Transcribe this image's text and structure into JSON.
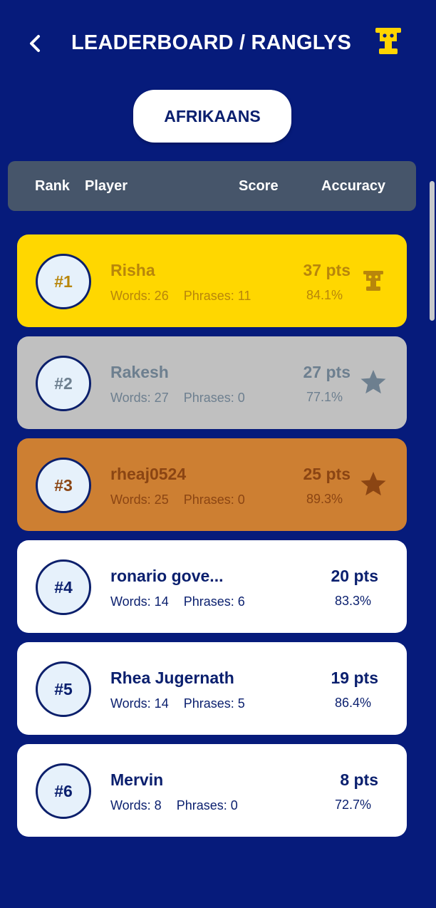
{
  "header": {
    "title": "LEADERBOARD / RANGLYS",
    "back_icon": "chevron-left-icon",
    "trophy_icon": "trophy-icon"
  },
  "language": {
    "label": "AFRIKAANS"
  },
  "columns": {
    "rank": "Rank",
    "player": "Player",
    "score": "Score",
    "accuracy": "Accuracy"
  },
  "colors": {
    "background": "#061b7b",
    "gold": "#ffd700",
    "silver": "#c0c0c0",
    "bronze": "#cd7f32",
    "header_bar": "#46556a"
  },
  "players": [
    {
      "rank": "#1",
      "name": "Risha",
      "words": "Words: 26",
      "phrases": "Phrases: 11",
      "score": "37 pts",
      "accuracy": "84.1%",
      "badge": "trophy-icon"
    },
    {
      "rank": "#2",
      "name": "Rakesh",
      "words": "Words: 27",
      "phrases": "Phrases: 0",
      "score": "27 pts",
      "accuracy": "77.1%",
      "badge": "star-icon"
    },
    {
      "rank": "#3",
      "name": "rheaj0524",
      "words": "Words: 25",
      "phrases": "Phrases: 0",
      "score": "25 pts",
      "accuracy": "89.3%",
      "badge": "star-icon"
    },
    {
      "rank": "#4",
      "name": "ronario gove...",
      "words": "Words: 14",
      "phrases": "Phrases: 6",
      "score": "20 pts",
      "accuracy": "83.3%"
    },
    {
      "rank": "#5",
      "name": "Rhea Jugernath",
      "words": "Words: 14",
      "phrases": "Phrases: 5",
      "score": "19 pts",
      "accuracy": "86.4%"
    },
    {
      "rank": "#6",
      "name": "Mervin",
      "words": "Words: 8",
      "phrases": "Phrases: 0",
      "score": "8 pts",
      "accuracy": "72.7%"
    }
  ]
}
